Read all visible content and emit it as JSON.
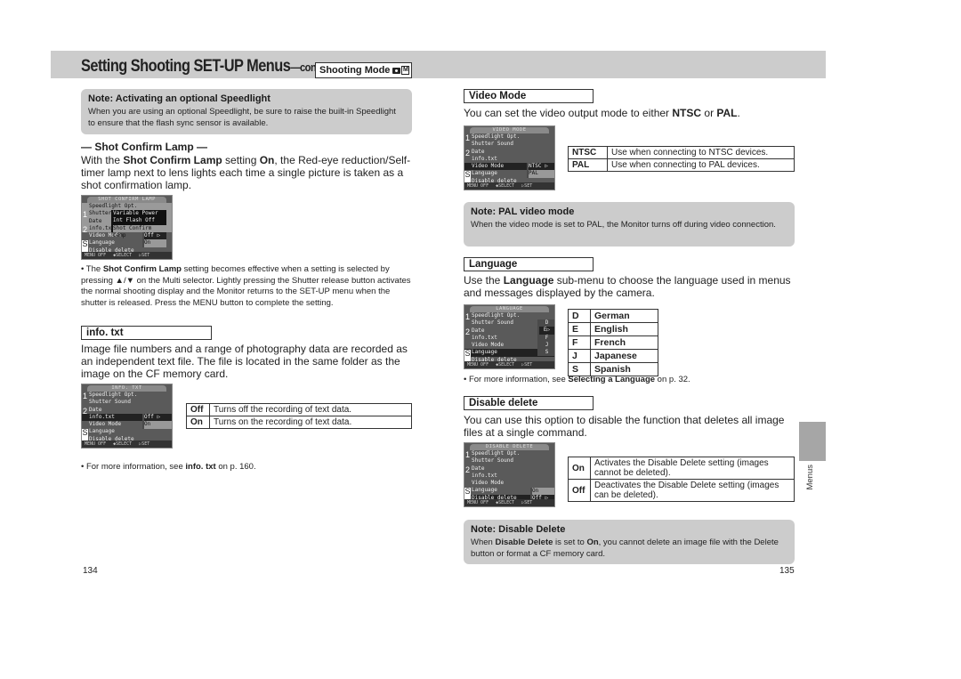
{
  "header": {
    "title": "Setting Shooting SET-UP Menus",
    "continued": "—continued",
    "mode_label": "Shooting Mode",
    "mode_icons": [
      "camera-icon",
      "manual-m-icon"
    ]
  },
  "left_page": {
    "note_speedlight": {
      "title": "Note: Activating an optional Speedlight",
      "body": "When you are using an optional Speedlight, be sure to raise the built-in Speedlight to ensure that the flash sync sensor is available."
    },
    "shot_confirm": {
      "heading": "— Shot Confirm Lamp —",
      "body_pre": "With the ",
      "body_bold1": "Shot Confirm Lamp",
      "body_mid": " setting ",
      "body_bold2": "On",
      "body_post": ", the Red-eye reduction/Self-timer lamp next to lens lights each time a single picture is taken as a shot confirmation lamp.",
      "lcd": {
        "title": "SHOT CONFIRM LAMP",
        "rows": [
          "Speedlight Opt.",
          "Shutter",
          "Date",
          "info.txt",
          "Video Mode",
          "Language",
          "Disable delete"
        ],
        "sub_items": [
          "Variable Power",
          "Int Flash Off",
          "Shot Confirm Lamp"
        ],
        "options": [
          "Off",
          "On"
        ],
        "footer": [
          "MENU OFF",
          "◆SELECT",
          "▷SET"
        ]
      },
      "bullet_pre": "The ",
      "bullet_bold": "Shot Confirm Lamp",
      "bullet_post": " setting becomes effective when a setting is selected by pressing ▲/▼ on the Multi selector. Lightly pressing the Shutter release button activates the normal shooting display and the Monitor returns to the SET-UP menu when the shutter is released. Press the MENU button to complete the setting."
    },
    "info_txt": {
      "heading": "info. txt",
      "body": "Image file numbers and a range of photography data are recorded as an independent text file. The file is located in the same folder as the image on the CF memory card.",
      "lcd": {
        "title": "INFO. TXT",
        "rows": [
          "Speedlight Opt.",
          "Shutter Sound",
          "Date",
          "info.txt",
          "Video Mode",
          "Language",
          "Disable delete"
        ],
        "options": [
          "Off",
          "On"
        ],
        "footer": [
          "MENU OFF",
          "◆SELECT",
          "▷SET"
        ]
      },
      "table": [
        {
          "key": "Off",
          "desc": "Turns off the recording of text data."
        },
        {
          "key": "On",
          "desc": "Turns on the recording of text data."
        }
      ],
      "more_pre": "For more information, see ",
      "more_bold": "info. txt",
      "more_post": " on p. 160."
    },
    "page_number": "134"
  },
  "right_page": {
    "video_mode": {
      "heading": "Video Mode",
      "body_pre": "You can set the video output mode to either ",
      "body_bold1": "NTSC",
      "body_mid": " or ",
      "body_bold2": "PAL",
      "body_post": ".",
      "lcd": {
        "title": "VIDEO MODE",
        "rows": [
          "Speedlight Opt.",
          "Shutter Sound",
          "Date",
          "info.txt",
          "Video Mode",
          "Language",
          "Disable delete"
        ],
        "options": [
          "NTSC",
          "PAL"
        ],
        "footer": [
          "MENU OFF",
          "◆SELECT",
          "▷SET"
        ]
      },
      "table": [
        {
          "key": "NTSC",
          "desc": "Use when connecting to NTSC devices."
        },
        {
          "key": "PAL",
          "desc": "Use when connecting to PAL devices."
        }
      ]
    },
    "note_pal": {
      "title": "Note: PAL video mode",
      "body": "When the video mode is set to PAL, the Monitor turns off during video connection."
    },
    "language": {
      "heading": "Language",
      "body_pre": "Use the ",
      "body_bold": "Language",
      "body_post": " sub-menu to choose the language used in menus and messages displayed by the camera.",
      "lcd": {
        "title": "LANGUAGE",
        "rows": [
          "Speedlight Opt.",
          "Shutter Sound",
          "Date",
          "info.txt",
          "Video Mode",
          "Language",
          "Disable delete"
        ],
        "options": [
          "D",
          "E",
          "F",
          "J",
          "S"
        ],
        "footer": [
          "MENU OFF",
          "◆SELECT",
          "▷SET"
        ]
      },
      "table": [
        {
          "key": "D",
          "desc": "German"
        },
        {
          "key": "E",
          "desc": "English"
        },
        {
          "key": "F",
          "desc": "French"
        },
        {
          "key": "J",
          "desc": "Japanese"
        },
        {
          "key": "S",
          "desc": "Spanish"
        }
      ],
      "more_pre": "For more information, see ",
      "more_bold": "Selecting a Language",
      "more_post": " on p. 32."
    },
    "disable_delete": {
      "heading": "Disable delete",
      "body": "You can use this option to disable the function that deletes all image files at a single command.",
      "lcd": {
        "title": "DISABLE DELETE",
        "rows": [
          "Speedlight Opt.",
          "Shutter Sound",
          "Date",
          "info.txt",
          "Video Mode",
          "Language",
          "Disable delete"
        ],
        "options": [
          "On",
          "Off"
        ],
        "footer": [
          "MENU OFF",
          "◆SELECT",
          "▷SET"
        ]
      },
      "table": [
        {
          "key": "On",
          "desc": "Activates the Disable Delete setting (images cannot be deleted)."
        },
        {
          "key": "Off",
          "desc": "Deactivates the Disable Delete setting (images can be deleted)."
        }
      ]
    },
    "note_disable": {
      "title": "Note: Disable Delete",
      "body_pre": "When ",
      "body_bold1": "Disable Delete",
      "body_mid": " is set to ",
      "body_bold2": "On",
      "body_post": ", you cannot delete an image file with the Delete button or format a CF memory card."
    },
    "side_tab": "Menus",
    "page_number": "135"
  }
}
